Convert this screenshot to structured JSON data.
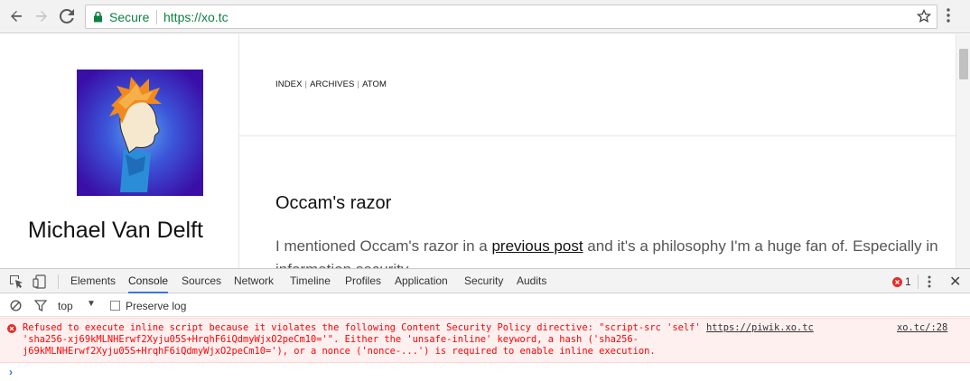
{
  "browser": {
    "secure_label": "Secure",
    "url": "https://xo.tc"
  },
  "page": {
    "author_name": "Michael Van Delft",
    "nav": [
      "INDEX",
      "ARCHIVES",
      "ATOM"
    ],
    "post_title": "Occam's razor",
    "post_text_before_link": "I mentioned Occam's razor in a ",
    "post_link": "previous post",
    "post_text_after_link": " and it's a philosophy I'm a huge fan of. Especially in information security."
  },
  "devtools": {
    "tabs": [
      "Elements",
      "Console",
      "Sources",
      "Network",
      "Timeline",
      "Profiles",
      "Application",
      "Security",
      "Audits"
    ],
    "active_tab": "Console",
    "error_count": "1",
    "context": "top",
    "preserve_log": "Preserve log",
    "error": {
      "line1_prefix": "Refused to execute inline script because it violates the following Content Security Policy directive: \"script-src 'self' ",
      "line1_link": "https://piwik.xo.tc",
      "line2": "'sha256-xj69kMLNHErwf2Xyju05S+HrqhF6iQdmyWjxO2peCm10='\". Either the 'unsafe-inline' keyword, a hash ('sha256-",
      "line3": "j69kMLNHErwf2Xyju05S+HrqhF6iQdmyWjxO2peCm10='), or a nonce ('nonce-...') is required to enable inline execution.",
      "source": "xo.tc/:28"
    },
    "prompt": "›"
  },
  "colors": {
    "secure_green": "#0b8043",
    "error_red": "#ff0000",
    "error_bg": "#fff0f0",
    "active_tab_blue": "#3879d9"
  }
}
